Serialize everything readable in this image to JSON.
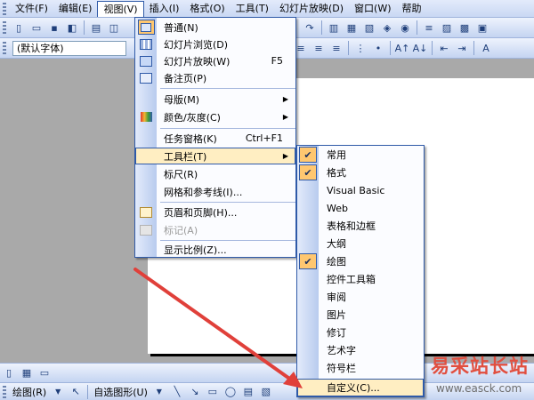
{
  "menubar": {
    "items": [
      "文件(F)",
      "编辑(E)",
      "视图(V)",
      "插入(I)",
      "格式(O)",
      "工具(T)",
      "幻灯片放映(D)",
      "窗口(W)",
      "帮助"
    ]
  },
  "toolbar_format": {
    "font": "(默认字体)"
  },
  "view_menu": {
    "items": [
      {
        "label": "普通(N)",
        "icon": "normal-view-icon",
        "selected": true
      },
      {
        "label": "幻灯片浏览(D)",
        "icon": "slide-sorter-icon"
      },
      {
        "label": "幻灯片放映(W)",
        "shortcut": "F5",
        "icon": "slideshow-icon"
      },
      {
        "label": "备注页(P)",
        "icon": "notes-page-icon"
      },
      {
        "label": "母版(M)",
        "submenu": true
      },
      {
        "label": "颜色/灰度(C)",
        "submenu": true,
        "icon": "color-grayscale-icon"
      },
      {
        "label": "任务窗格(K)",
        "shortcut": "Ctrl+F1"
      },
      {
        "label": "工具栏(T)",
        "submenu": true,
        "highlighted": true
      },
      {
        "label": "标尺(R)"
      },
      {
        "label": "网格和参考线(I)..."
      },
      {
        "label": "页眉和页脚(H)...",
        "icon": "header-footer-icon"
      },
      {
        "label": "标记(A)",
        "disabled": true,
        "icon": "markup-icon"
      },
      {
        "label": "显示比例(Z)..."
      }
    ]
  },
  "toolbar_submenu": {
    "items": [
      {
        "label": "常用",
        "checked": true
      },
      {
        "label": "格式",
        "checked": true
      },
      {
        "label": "Visual Basic"
      },
      {
        "label": "Web"
      },
      {
        "label": "表格和边框"
      },
      {
        "label": "大纲"
      },
      {
        "label": "绘图",
        "checked": true
      },
      {
        "label": "控件工具箱"
      },
      {
        "label": "审阅"
      },
      {
        "label": "图片"
      },
      {
        "label": "修订"
      },
      {
        "label": "艺术字"
      },
      {
        "label": "符号栏"
      },
      {
        "label": "自定义(C)...",
        "highlighted": true
      }
    ]
  },
  "drawing_toolbar": {
    "draw": "绘图(R)",
    "autoshapes": "自选图形(U)"
  },
  "watermark": {
    "text": "易采站长站",
    "url": "www.easck.com"
  },
  "colors": {
    "accent": "#2f5aa8",
    "highlight": "#ffeec2",
    "check": "#ffc770",
    "arrow": "#e0403a"
  }
}
